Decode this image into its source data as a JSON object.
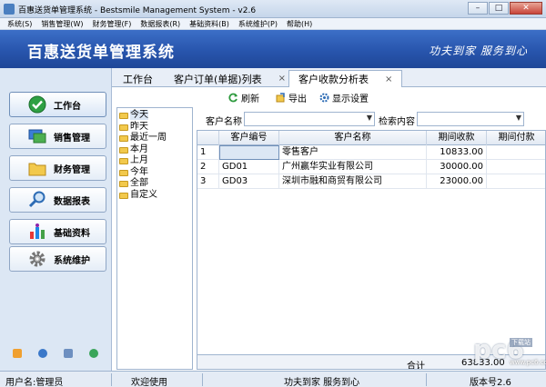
{
  "window": {
    "title": "百惠送货单管理系统 - Bestsmile Management System - v2.6",
    "minimize": "–",
    "maximize": "□",
    "close": "✕"
  },
  "menu": [
    "系统(S)",
    "销售管理(W)",
    "财务管理(F)",
    "数据报表(R)",
    "基础资料(B)",
    "系统维护(P)",
    "帮助(H)"
  ],
  "banner": {
    "title": "百惠送货单管理系统",
    "slogan": "功夫到家 服务到心"
  },
  "sidebar": {
    "items": [
      {
        "label": "工作台",
        "icon": "check-icon"
      },
      {
        "label": "销售管理",
        "icon": "monitor-icon"
      },
      {
        "label": "财务管理",
        "icon": "folder-icon"
      },
      {
        "label": "数据报表",
        "icon": "magnifier-icon"
      },
      {
        "label": "基础资料",
        "icon": "chart-icon"
      },
      {
        "label": "系统维护",
        "icon": "gear-icon"
      }
    ]
  },
  "tabs": [
    {
      "label": "工作台",
      "closable": false
    },
    {
      "label": "客户订单(单据)列表",
      "closable": true
    },
    {
      "label": "客户收款分析表",
      "closable": true,
      "active": true
    }
  ],
  "tab_close_glyph": "×",
  "toolbar": {
    "refresh": "刷新",
    "export": "导出",
    "display_settings": "显示设置"
  },
  "tree": {
    "items": [
      "今天",
      "昨天",
      "最近一周",
      "本月",
      "上月",
      "今年",
      "全部",
      "自定义"
    ],
    "selected": 0
  },
  "filter": {
    "customer_name_label": "客户名称",
    "search_label": "检索内容",
    "customer_name_value": "",
    "search_value": ""
  },
  "grid": {
    "columns": [
      "",
      "客户编号",
      "客户名称",
      "期间收款",
      "期间付款"
    ],
    "rows": [
      {
        "no": "1",
        "code": "",
        "name": "零售客户",
        "receipt": "10833.00",
        "payment": ""
      },
      {
        "no": "2",
        "code": "GD01",
        "name": "广州赢华实业有限公司",
        "receipt": "30000.00",
        "payment": ""
      },
      {
        "no": "3",
        "code": "GD03",
        "name": "深圳市融和商贸有限公司",
        "receipt": "23000.00",
        "payment": ""
      }
    ],
    "footer_label": "合计",
    "footer_value": "63833.00"
  },
  "status": {
    "user": "用户名:管理员",
    "welcome": "欢迎使用",
    "slogan": "功夫到家 服务到心",
    "version": "版本号2.6"
  },
  "watermark": {
    "text": "pc6",
    "badge": "下载站",
    "url": "www.pc6.com"
  },
  "colors": {
    "banner": "#2855ad",
    "accent": "#3c6fc7"
  }
}
